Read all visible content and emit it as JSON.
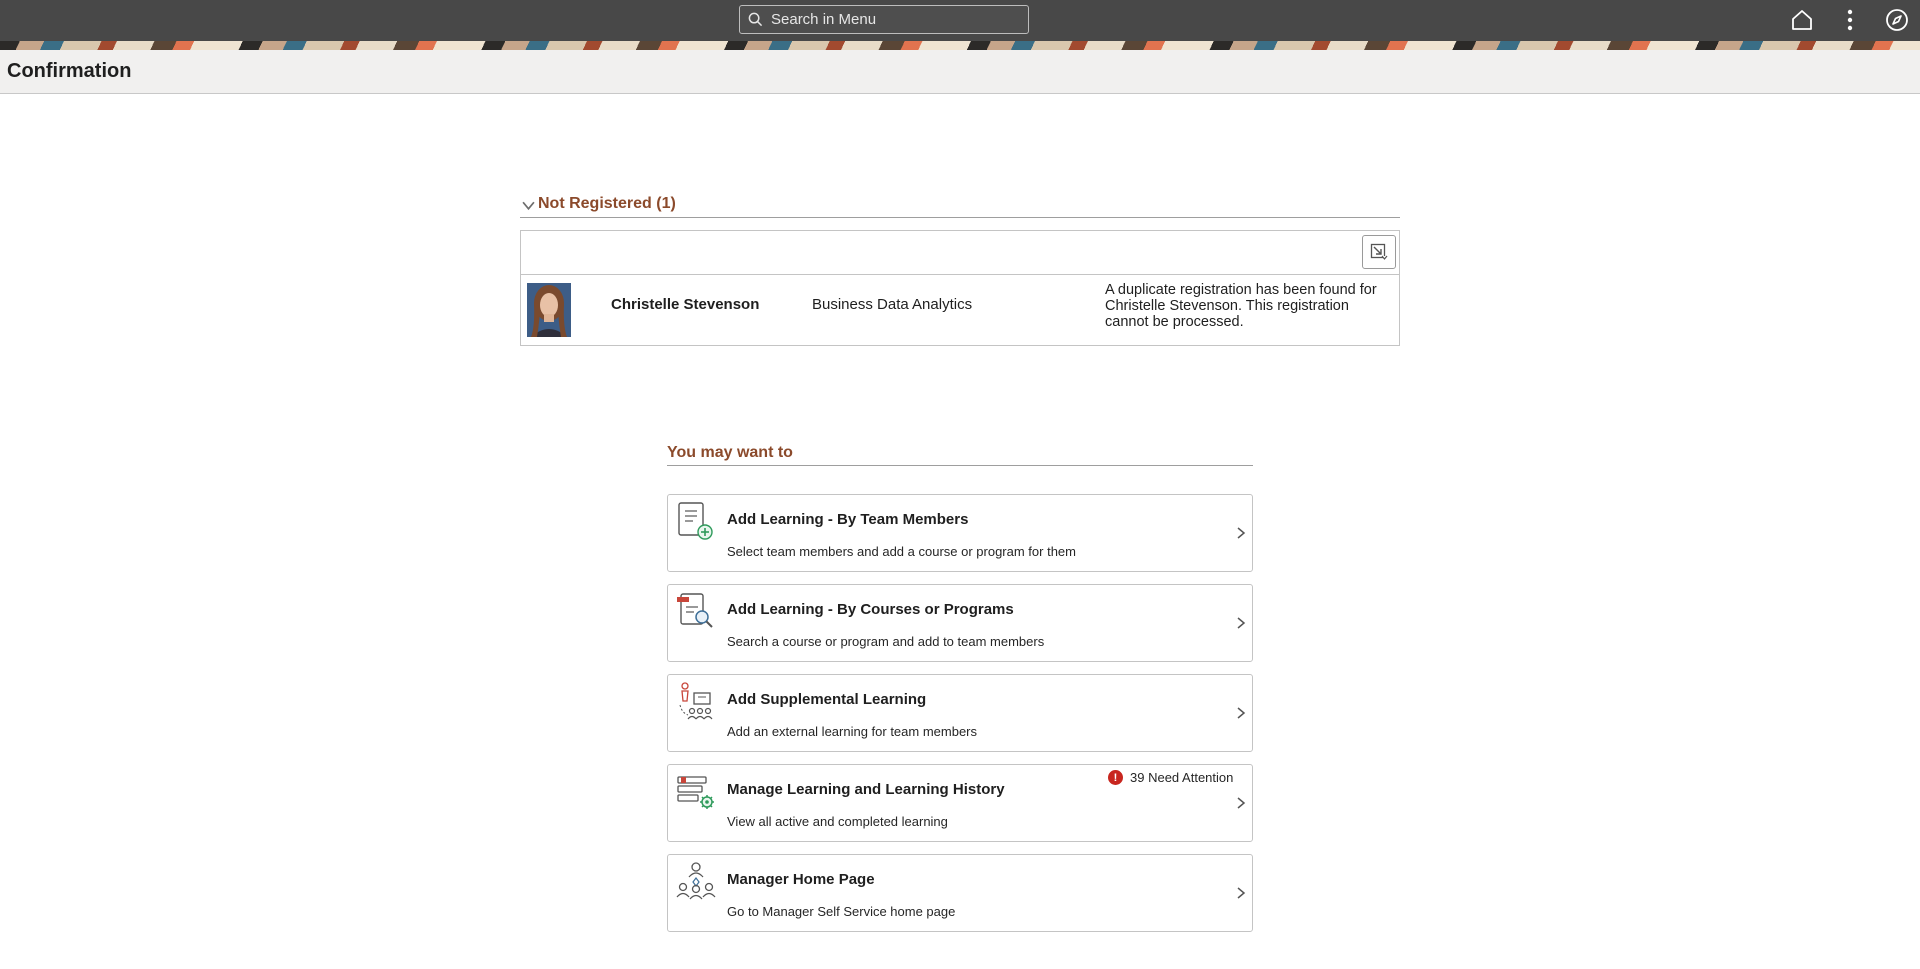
{
  "header": {
    "search_placeholder": "Search in Menu",
    "icons": [
      "home-icon",
      "actions-menu-icon",
      "navbar-compass-icon"
    ]
  },
  "page": {
    "title": "Confirmation"
  },
  "not_registered": {
    "section_title": "Not Registered (1)",
    "rows": [
      {
        "name": "Christelle Stevenson",
        "course": "Business Data Analytics",
        "message": "A duplicate registration has been found for Christelle Stevenson. This registration cannot be processed."
      }
    ]
  },
  "you_may_want_to": {
    "title": "You may want to",
    "tiles": [
      {
        "title": "Add Learning - By Team Members",
        "description": "Select team members and add a course or program for them",
        "icon": "add-learning-team-icon"
      },
      {
        "title": "Add Learning - By Courses or Programs",
        "description": "Search a course or program and add to team members",
        "icon": "search-courses-icon"
      },
      {
        "title": "Add Supplemental Learning",
        "description": "Add an external learning for team members",
        "icon": "supplemental-learning-icon"
      },
      {
        "title": "Manage Learning and Learning History",
        "description": "View all active and completed learning",
        "icon": "manage-learning-icon",
        "badge": "39 Need Attention"
      },
      {
        "title": "Manager Home Page",
        "description": "Go to Manager Self Service home page",
        "icon": "manager-team-icon"
      }
    ]
  },
  "colors": {
    "header_bg": "#484848",
    "section_title": "#8b4a2b",
    "alert": "#c8261f"
  }
}
